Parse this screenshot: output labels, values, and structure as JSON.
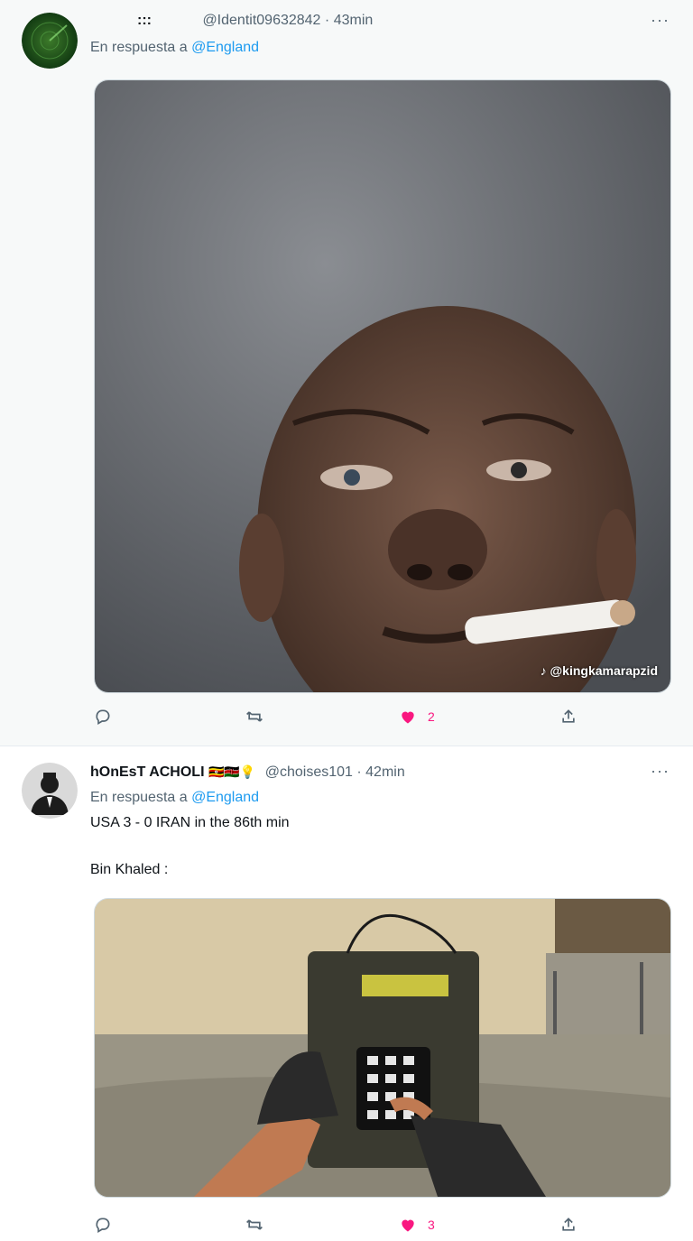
{
  "tweets": [
    {
      "name": ":::",
      "handle": "@Identit09632842",
      "time": "43min",
      "reply_prefix": "En respuesta a",
      "reply_to": "@England",
      "text_lines": [],
      "media_watermark": "@kingkamarapzid",
      "likes": "2",
      "avatar_icon": "radar-avatar"
    },
    {
      "name": "hOnEsT ACHOLI",
      "name_emojis": "🇺🇬🇰🇪💡",
      "handle": "@choises101",
      "time": "42min",
      "reply_prefix": "En respuesta a",
      "reply_to": "@England",
      "text_lines": [
        "USA 3 - 0 IRAN in the 86th min",
        "Bin Khaled :"
      ],
      "likes": "3",
      "avatar_icon": "person-avatar"
    }
  ],
  "separator": "·",
  "more_label": "···",
  "colors": {
    "link": "#1d9bf0",
    "like": "#f91880",
    "muted": "#536471"
  },
  "icons": [
    "reply-icon",
    "retweet-icon",
    "heart-icon",
    "share-icon",
    "more-icon"
  ]
}
